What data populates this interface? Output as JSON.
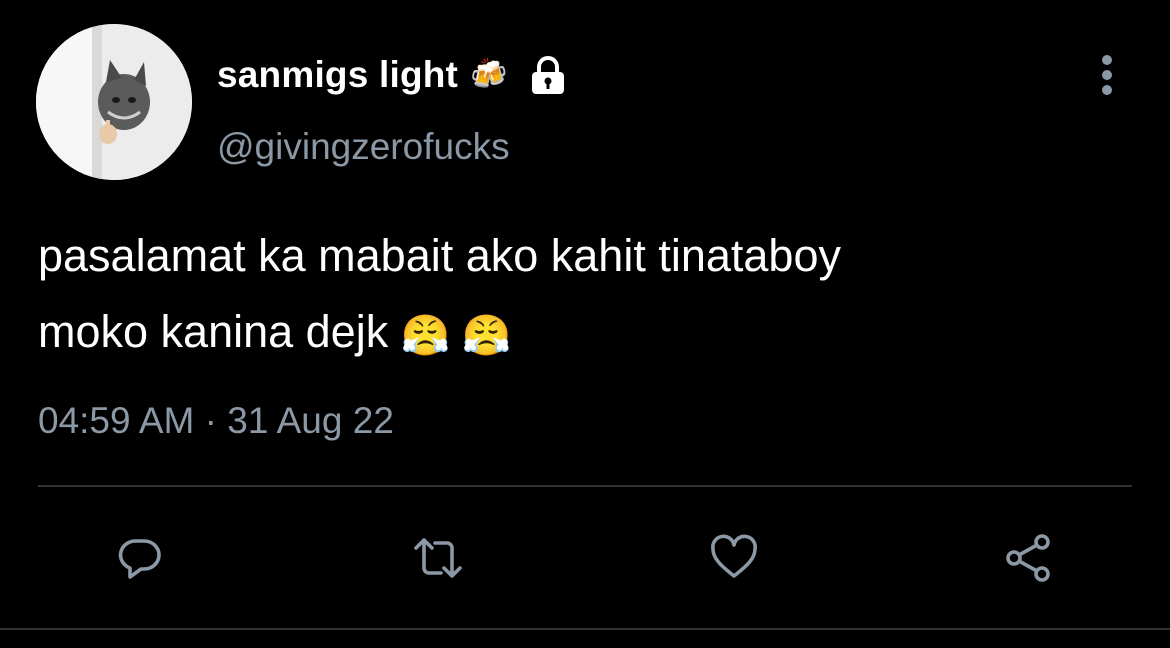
{
  "tweet": {
    "author": {
      "display_name": "sanmigs light",
      "name_emoji": "🍻",
      "protected_icon": "lock-icon",
      "handle": "@givingzerofucks",
      "avatar_icon": "cat-avatar"
    },
    "text": {
      "line1": "pasalamat ka mabait ako kahit tinataboy",
      "line2": "moko kanina dejk",
      "emojis": "😤 😤"
    },
    "time": "04:59 AM",
    "separator": "·",
    "date": "31 Aug 22",
    "actions": {
      "reply": "reply-icon",
      "retweet": "retweet-icon",
      "like": "heart-icon",
      "share": "share-icon"
    },
    "more_icon": "more-vertical-icon"
  },
  "colors": {
    "background": "#000000",
    "text": "#ffffff",
    "secondary": "#8b98a5",
    "divider": "#2f3336"
  }
}
